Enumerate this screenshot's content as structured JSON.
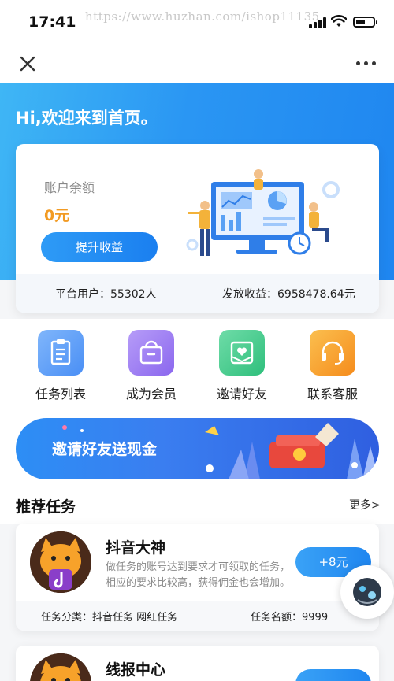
{
  "status_bar": {
    "time": "17:41",
    "watermark": "https://www.huzhan.com/ishop11135"
  },
  "nav": {
    "close_icon": "close-icon",
    "more_icon": "more-dots-icon"
  },
  "hero": {
    "welcome": "Hi,欢迎来到首页。"
  },
  "account": {
    "balance_label": "账户余额",
    "balance_value": "0元",
    "upgrade_button": "提升收益",
    "platform_users": "平台用户：55302人",
    "paid_income": "发放收益：6958478.64元"
  },
  "menu": {
    "items": [
      {
        "label": "任务列表",
        "icon": "clipboard-icon",
        "color": "#5b9df8"
      },
      {
        "label": "成为会员",
        "icon": "bag-icon",
        "color": "#9b7bf3"
      },
      {
        "label": "邀请好友",
        "icon": "invite-heart-icon",
        "color": "#3dc98a"
      },
      {
        "label": "联系客服",
        "icon": "headset-icon",
        "color": "#f7a128"
      }
    ]
  },
  "banner": {
    "text": "邀请好友送现金"
  },
  "recommend": {
    "title": "推荐任务",
    "more": "更多>"
  },
  "tasks": [
    {
      "name": "抖音大神",
      "desc": "做任务的账号达到要求才可领取的任务，相应的要求比较高，获得佣金也会增加。",
      "reward": "+8元",
      "category": "任务分类：抖音任务 网红任务",
      "quota": "任务名额：9999"
    },
    {
      "name": "线报中心",
      "desc": "",
      "reward": "",
      "category": "",
      "quota": ""
    }
  ],
  "colors": {
    "primary": "#1f86f0",
    "accent_orange": "#f29b24"
  }
}
